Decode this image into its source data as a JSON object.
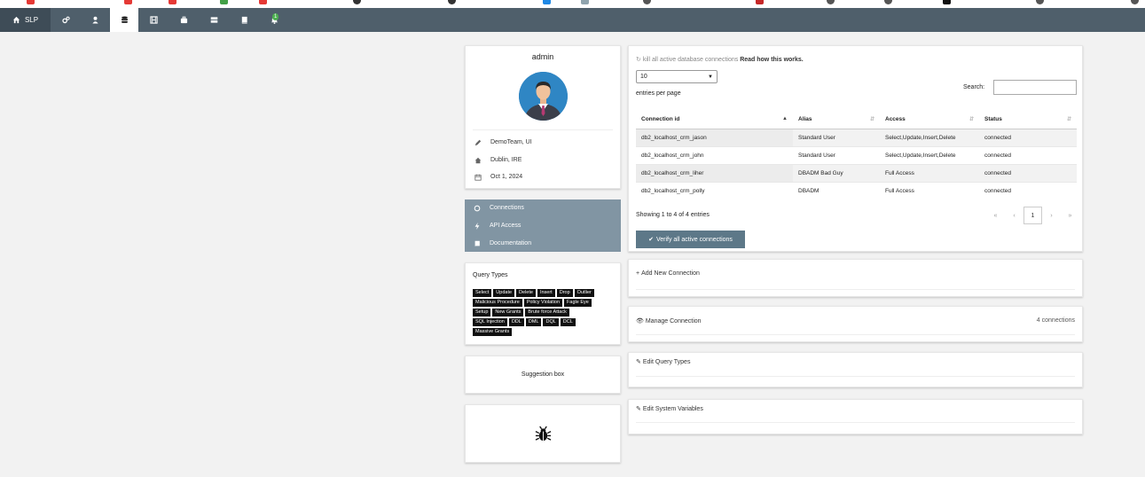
{
  "navbar": {
    "brand": "SLP",
    "notification_count": "1",
    "icons": [
      "home-icon",
      "cogs-icon",
      "user-icon",
      "database-icon",
      "film-icon",
      "briefcase-icon",
      "server-icon",
      "book-icon",
      "bell-icon"
    ]
  },
  "profile": {
    "name": "admin",
    "team": "DemoTeam, UI",
    "location": "Dublin, IRE",
    "date": "Oct 1, 2024"
  },
  "side_menu": {
    "items": [
      {
        "label": "Connections",
        "icon": "circle-icon"
      },
      {
        "label": "API Access",
        "icon": "bolt-icon"
      },
      {
        "label": "Documentation",
        "icon": "book-icon"
      }
    ]
  },
  "query_types": {
    "title": "Query Types",
    "rows": [
      [
        "Select",
        "Update",
        "Delete",
        "Insert",
        "Drop",
        "Outlier"
      ],
      [
        "Malicious Procedure",
        "Policy Violation",
        "Fagle Eye"
      ],
      [
        "Setup",
        "New Grants",
        "Brute force Attack"
      ],
      [
        "SQL Injection",
        "DDL",
        "DML",
        "DQL",
        "DCL"
      ],
      [
        "Massive Grants"
      ]
    ]
  },
  "suggestion_box": {
    "label": "Suggestion box"
  },
  "bug_report": {
    "icon": "bug-icon"
  },
  "connections": {
    "kill_text": "kill all active database connections",
    "read_more": "Read how this works.",
    "page_size": "10",
    "entries_per_page": "entries per page",
    "search_label": "Search:",
    "search_value": "",
    "columns": [
      "Connection id",
      "Alias",
      "Access",
      "Status"
    ],
    "rows": [
      [
        "db2_localhost_crm_jason",
        "Standard User",
        "Select,Update,Insert,Delete",
        "connected"
      ],
      [
        "db2_localhost_crm_john",
        "Standard User",
        "Select,Update,Insert,Delete",
        "connected"
      ],
      [
        "db2_localhost_crm_liher",
        "DBADM Bad Guy",
        "Full Access",
        "connected"
      ],
      [
        "db2_localhost_crm_polly",
        "DBADM",
        "Full Access",
        "connected"
      ]
    ],
    "showing": "Showing 1 to 4 of 4 entries",
    "pager": {
      "first": "«",
      "prev": "‹",
      "current": "1",
      "next": "›",
      "last": "»"
    },
    "verify_label": "Verify all active connections"
  },
  "add_connection": {
    "label": "Add New Connection"
  },
  "manage_connection": {
    "label": "Manage Connection",
    "count": "4 connections"
  },
  "edit_query_types": {
    "label": "Edit Query Types"
  },
  "edit_system_variables": {
    "label": "Edit System Variables"
  }
}
